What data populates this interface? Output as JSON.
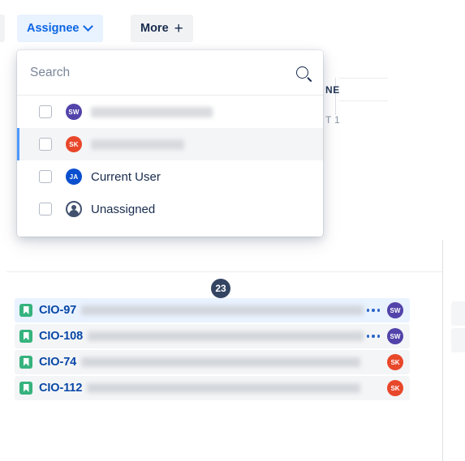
{
  "toolbar": {
    "assignee_label": "Assignee",
    "assignee_chevron_icon": "chevron-down-icon",
    "more_label": "More",
    "more_plus_icon": "plus-icon"
  },
  "dropdown": {
    "search_placeholder": "Search",
    "search_value": "",
    "search_icon": "search-icon",
    "items": [
      {
        "label": "",
        "redacted": true,
        "redact_width": 150,
        "initials": "SW",
        "avatar_color": "#5243AA",
        "checked": false,
        "selected": false,
        "avatar_type": "initials"
      },
      {
        "label": "",
        "redacted": true,
        "redact_width": 115,
        "initials": "SK",
        "avatar_color": "#E8472A",
        "checked": false,
        "selected": true,
        "avatar_type": "initials"
      },
      {
        "label": "Current User",
        "redacted": false,
        "redact_width": 0,
        "initials": "JA",
        "avatar_color": "#0B4FCE",
        "checked": false,
        "selected": false,
        "avatar_type": "initials"
      },
      {
        "label": "Unassigned",
        "redacted": false,
        "redact_width": 0,
        "initials": "",
        "avatar_color": "#42526E",
        "checked": false,
        "selected": false,
        "avatar_type": "person"
      }
    ]
  },
  "board": {
    "column_header_partial": "NE",
    "sprint_label_partial": "T 1",
    "count_badge": "23"
  },
  "issues": [
    {
      "key": "CIO-97",
      "summary": "",
      "type_icon": "story-icon",
      "has_more_dots": true,
      "initials": "SW",
      "avatar_color": "#5243AA",
      "active": true
    },
    {
      "key": "CIO-108",
      "summary": "",
      "type_icon": "story-icon",
      "has_more_dots": true,
      "initials": "SW",
      "avatar_color": "#5243AA",
      "active": false
    },
    {
      "key": "CIO-74",
      "summary": "",
      "type_icon": "story-icon",
      "has_more_dots": false,
      "initials": "SK",
      "avatar_color": "#E8472A",
      "active": false
    },
    {
      "key": "CIO-112",
      "summary": "",
      "type_icon": "story-icon",
      "has_more_dots": false,
      "initials": "SK",
      "avatar_color": "#E8472A",
      "active": false
    }
  ],
  "colors": {
    "accent_blue": "#0c66e4",
    "selected_bg": "#e9f2ff",
    "row_bg": "#f4f5f7",
    "key_link": "#0747a6",
    "story_green": "#36b37e",
    "badge_navy": "#344563"
  }
}
